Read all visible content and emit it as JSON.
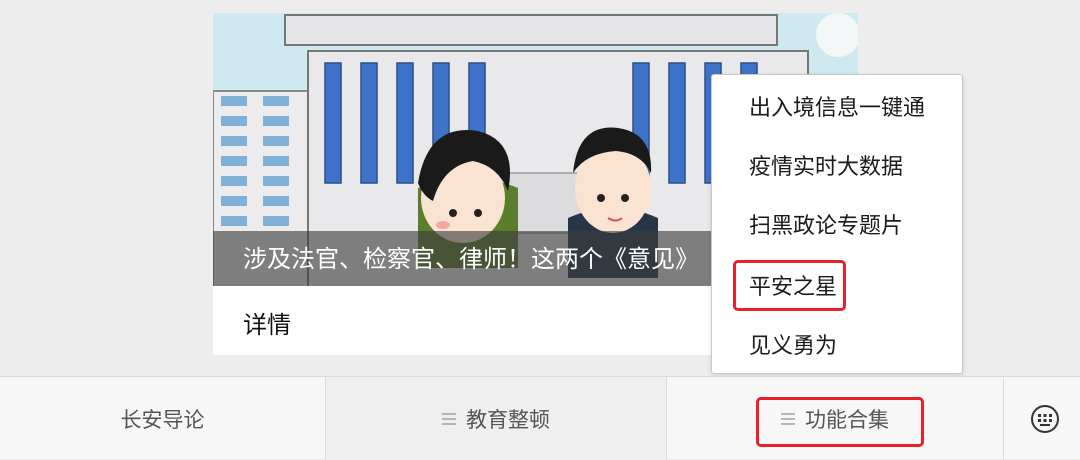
{
  "article": {
    "caption": "涉及法官、检察官、律师！这两个《意见》",
    "details_label": "详情"
  },
  "popup_menu": {
    "items": [
      "出入境信息一键通",
      "疫情实时大数据",
      "扫黑政论专题片",
      "平安之星",
      "见义勇为"
    ],
    "highlighted_item": "平安之星"
  },
  "bottom_nav": {
    "tabs": [
      "长安导论",
      "教育整顿",
      "功能合集"
    ],
    "active_tab": "功能合集"
  },
  "icons": {
    "keyboard": "keyboard-icon",
    "menu": "menu-lines-icon"
  },
  "colors": {
    "highlight_border": "#e8202a",
    "background": "#ededed"
  }
}
